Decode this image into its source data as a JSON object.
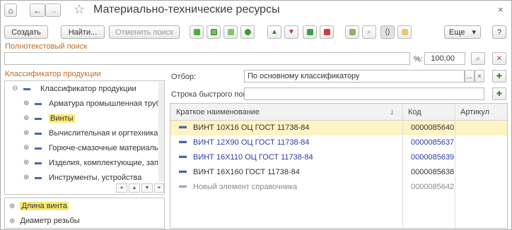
{
  "window": {
    "title": "Материально-технические ресурсы",
    "home_icon": "⌂",
    "back_icon": "←",
    "forward_icon": "→",
    "favorite_icon": "☆",
    "close_icon": "×"
  },
  "toolbar": {
    "create_label": "Создать",
    "find_label": "Найти...",
    "cancel_search_label": "Отменить поиск",
    "more_label": "Еще",
    "more_arrow": "▾",
    "help_label": "?"
  },
  "fulltext": {
    "label": "Полнотекстовый поиск",
    "value": "",
    "percent_label": "%:",
    "percent_value": "100,00"
  },
  "classifier": {
    "label": "Классификатор продукции",
    "items": [
      {
        "label": "Классификатор продукции",
        "level": 0,
        "highlighted": false
      },
      {
        "label": "Арматура промышленная трубопрово",
        "level": 1,
        "highlighted": false
      },
      {
        "label": "Винты",
        "level": 1,
        "highlighted": true
      },
      {
        "label": "Вычислительная и оргтехника, ПО",
        "level": 1,
        "highlighted": false
      },
      {
        "label": "Горюче-смазочные материалы",
        "level": 1,
        "highlighted": false
      },
      {
        "label": "Изделия, комплектующие, зап.части,",
        "level": 1,
        "highlighted": false
      },
      {
        "label": "Инструменты, устройства",
        "level": 1,
        "highlighted": false
      }
    ]
  },
  "attributes": {
    "items": [
      {
        "label": "Длина винта",
        "highlighted": true
      },
      {
        "label": "Диаметр резьбы",
        "highlighted": false
      }
    ]
  },
  "filter": {
    "label": "Отбор:",
    "value": "По основному классификатору",
    "dots": "...",
    "clear": "×"
  },
  "quick_search": {
    "label": "Строка быстрого поиска:",
    "value": ""
  },
  "grid": {
    "columns": [
      "Краткое наименование",
      "Код",
      "Артикул"
    ],
    "sort_arrow": "↓",
    "rows": [
      {
        "name": "ВИНТ 10Х16 ОЦ ГОСТ 11738-84",
        "code": "0000085640",
        "article": "",
        "color": "#333333",
        "selected": true
      },
      {
        "name": "ВИНТ 12Х90 ОЦ ГОСТ 11738-84",
        "code": "0000085637",
        "article": "",
        "color": "#2b3c9e",
        "selected": false
      },
      {
        "name": "ВИНТ 16Х110 ОЦ ГОСТ 11738-84",
        "code": "0000085639",
        "article": "",
        "color": "#2b3c9e",
        "selected": false
      },
      {
        "name": "ВИНТ 16Х160 ГОСТ 11738-84",
        "code": "0000085638",
        "article": "",
        "color": "#333333",
        "selected": false
      },
      {
        "name": "Новый элемент справочника",
        "code": "0000085642",
        "article": "",
        "color": "#8a8a8a",
        "selected": false
      }
    ]
  },
  "colors": {
    "accent_orange": "#c26a1f",
    "highlight_yellow": "#fbe86e",
    "selected_row": "#fdf3c4",
    "link_blue": "#2b3c9e"
  }
}
